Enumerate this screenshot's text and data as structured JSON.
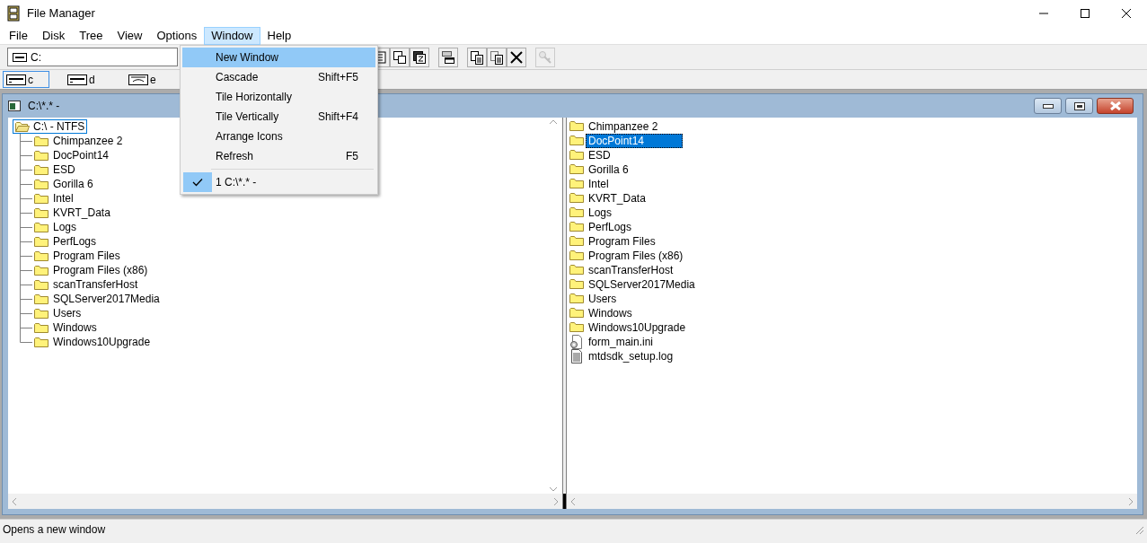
{
  "window": {
    "title": "File Manager"
  },
  "menu": [
    {
      "label": "File",
      "selected": false
    },
    {
      "label": "Disk",
      "selected": false
    },
    {
      "label": "Tree",
      "selected": false
    },
    {
      "label": "View",
      "selected": false
    },
    {
      "label": "Options",
      "selected": false
    },
    {
      "label": "Window",
      "selected": true
    },
    {
      "label": "Help",
      "selected": false
    }
  ],
  "toolbar": {
    "drive_combo": {
      "value": "C:"
    },
    "buttons": [
      {
        "kind": "sort-name",
        "disabled": false
      },
      {
        "kind": "cascade",
        "disabled": false
      },
      {
        "kind": "sort-size",
        "disabled": false
      },
      {
        "kind": "network",
        "disabled": false
      },
      {
        "kind": "copy",
        "disabled": false
      },
      {
        "kind": "move",
        "disabled": false
      },
      {
        "kind": "delete",
        "disabled": false
      },
      {
        "kind": "key",
        "disabled": true
      }
    ]
  },
  "drives": [
    {
      "label": "c",
      "kind": "fixed",
      "selected": true
    },
    {
      "label": "d",
      "kind": "fixed",
      "selected": false
    },
    {
      "label": "e",
      "kind": "removable",
      "selected": false
    }
  ],
  "window_menu": {
    "items": [
      {
        "kind": "item",
        "label": "New Window",
        "selected": true,
        "checked": false
      },
      {
        "kind": "item",
        "label": "Cascade",
        "shortcut": "Shift+F5",
        "selected": false,
        "checked": false
      },
      {
        "kind": "item",
        "label": "Tile Horizontally",
        "selected": false,
        "checked": false
      },
      {
        "kind": "item",
        "label": "Tile Vertically",
        "shortcut": "Shift+F4",
        "selected": false,
        "checked": false
      },
      {
        "kind": "item",
        "label": "Arrange Icons",
        "selected": false,
        "checked": false
      },
      {
        "kind": "item",
        "label": "Refresh",
        "shortcut": "F5",
        "selected": false,
        "checked": false
      },
      {
        "kind": "separator"
      },
      {
        "kind": "item",
        "label": "1 C:\\*.* -",
        "selected": false,
        "checked": true
      }
    ]
  },
  "child_window": {
    "title": "C:\\*.* -",
    "tree": {
      "label": "C:\\ - NTFS",
      "selected": true,
      "children": [
        {
          "label": "Chimpanzee 2",
          "selected": false
        },
        {
          "label": "DocPoint14",
          "selected": false
        },
        {
          "label": "ESD",
          "selected": false
        },
        {
          "label": "Gorilla 6",
          "selected": false
        },
        {
          "label": "Intel",
          "selected": false
        },
        {
          "label": "KVRT_Data",
          "selected": false
        },
        {
          "label": "Logs",
          "selected": false
        },
        {
          "label": "PerfLogs",
          "selected": false
        },
        {
          "label": "Program Files",
          "selected": false
        },
        {
          "label": "Program Files (x86)",
          "selected": false
        },
        {
          "label": "scanTransferHost",
          "selected": false
        },
        {
          "label": "SQLServer2017Media",
          "selected": false
        },
        {
          "label": "Users",
          "selected": false
        },
        {
          "label": "Windows",
          "selected": false
        },
        {
          "label": "Windows10Upgrade",
          "selected": false
        }
      ]
    },
    "files": [
      {
        "name": "Chimpanzee 2",
        "kind": "folder",
        "selected": false
      },
      {
        "name": "DocPoint14",
        "kind": "folder",
        "selected": true
      },
      {
        "name": "ESD",
        "kind": "folder",
        "selected": false
      },
      {
        "name": "Gorilla 6",
        "kind": "folder",
        "selected": false
      },
      {
        "name": "Intel",
        "kind": "folder",
        "selected": false
      },
      {
        "name": "KVRT_Data",
        "kind": "folder",
        "selected": false
      },
      {
        "name": "Logs",
        "kind": "folder",
        "selected": false
      },
      {
        "name": "PerfLogs",
        "kind": "folder",
        "selected": false
      },
      {
        "name": "Program Files",
        "kind": "folder",
        "selected": false
      },
      {
        "name": "Program Files (x86)",
        "kind": "folder",
        "selected": false
      },
      {
        "name": "scanTransferHost",
        "kind": "folder",
        "selected": false
      },
      {
        "name": "SQLServer2017Media",
        "kind": "folder",
        "selected": false
      },
      {
        "name": "Users",
        "kind": "folder",
        "selected": false
      },
      {
        "name": "Windows",
        "kind": "folder",
        "selected": false
      },
      {
        "name": "Windows10Upgrade",
        "kind": "folder",
        "selected": false
      },
      {
        "name": "form_main.ini",
        "kind": "settings",
        "selected": false
      },
      {
        "name": "mtdsdk_setup.log",
        "kind": "text",
        "selected": false
      }
    ]
  },
  "status_bar": {
    "text": "Opens a new window"
  }
}
